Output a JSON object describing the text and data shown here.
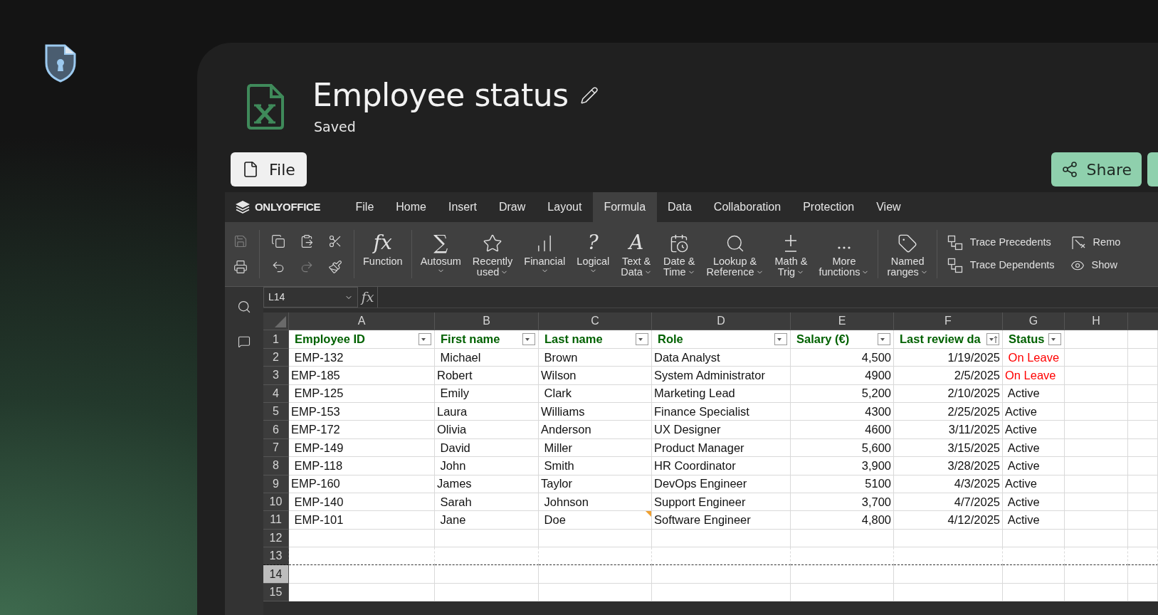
{
  "document": {
    "title": "Employee status",
    "status": "Saved"
  },
  "file_button": {
    "label": "File"
  },
  "share_button": {
    "label": "Share"
  },
  "editor": {
    "brand": "ONLYOFFICE",
    "menu": [
      {
        "label": "File",
        "selected": false
      },
      {
        "label": "Home",
        "selected": false
      },
      {
        "label": "Insert",
        "selected": false
      },
      {
        "label": "Draw",
        "selected": false
      },
      {
        "label": "Layout",
        "selected": false
      },
      {
        "label": "Formula",
        "selected": true
      },
      {
        "label": "Data",
        "selected": false
      },
      {
        "label": "Collaboration",
        "selected": false
      },
      {
        "label": "Protection",
        "selected": false
      },
      {
        "label": "View",
        "selected": false
      }
    ],
    "small_tools": [
      {
        "disabled": true
      },
      {
        "disabled": false
      },
      {
        "disabled": false
      },
      {
        "disabled": false
      },
      {
        "disabled": false
      },
      {
        "disabled": false
      },
      {
        "disabled": true
      },
      {
        "disabled": false
      }
    ],
    "function_groups": [
      [
        {
          "lines": [
            "Function"
          ],
          "symbol": "fx",
          "has_menu": false
        }
      ],
      [
        {
          "lines": [
            "Autosum"
          ],
          "symbol": "∑",
          "has_menu": true,
          "caret_on_own_line": true
        },
        {
          "lines": [
            "Recently",
            "used"
          ],
          "has_menu": true,
          "caret_on_own_line": false
        },
        {
          "lines": [
            "Financial"
          ],
          "has_menu": true,
          "caret_on_own_line": true
        },
        {
          "lines": [
            "Logical"
          ],
          "symbol": "?",
          "has_menu": true,
          "caret_on_own_line": true
        },
        {
          "lines": [
            "Text &",
            "Data"
          ],
          "symbol": "A",
          "has_menu": true,
          "caret_on_own_line": false
        },
        {
          "lines": [
            "Date &",
            "Time"
          ],
          "has_menu": true,
          "caret_on_own_line": false
        },
        {
          "lines": [
            "Lookup &",
            "Reference"
          ],
          "has_menu": true,
          "caret_on_own_line": false
        },
        {
          "lines": [
            "Math &",
            "Trig"
          ],
          "has_menu": true,
          "caret_on_own_line": false
        },
        {
          "lines": [
            "More",
            "functions"
          ],
          "has_menu": true,
          "caret_on_own_line": false
        }
      ],
      [
        {
          "lines": [
            "Named",
            "ranges"
          ],
          "has_menu": true,
          "caret_on_own_line": false
        }
      ]
    ],
    "trace_tools": [
      {
        "label": "Trace Precedents"
      },
      {
        "label": "Trace Dependents"
      },
      {
        "label": "Remo"
      },
      {
        "label": "Show"
      }
    ],
    "name_box": "L14",
    "formula_symbol": "fx"
  },
  "sheet": {
    "columns": [
      "A",
      "B",
      "C",
      "D",
      "E",
      "F",
      "G",
      "H"
    ],
    "row_numbers": [
      {
        "label": "1",
        "selected": false,
        "page_break": false
      },
      {
        "label": "2",
        "selected": false,
        "page_break": false
      },
      {
        "label": "3",
        "selected": false,
        "page_break": false
      },
      {
        "label": "4",
        "selected": false,
        "page_break": false
      },
      {
        "label": "5",
        "selected": false,
        "page_break": false
      },
      {
        "label": "6",
        "selected": false,
        "page_break": false
      },
      {
        "label": "7",
        "selected": false,
        "page_break": false
      },
      {
        "label": "8",
        "selected": false,
        "page_break": false
      },
      {
        "label": "9",
        "selected": false,
        "page_break": false
      },
      {
        "label": "10",
        "selected": false,
        "page_break": false
      },
      {
        "label": "11",
        "selected": false,
        "page_break": false
      },
      {
        "label": "12",
        "selected": false,
        "page_break": false
      },
      {
        "label": "13",
        "selected": false,
        "page_break": true
      },
      {
        "label": "14",
        "selected": true,
        "page_break": false
      },
      {
        "label": "15",
        "selected": false,
        "page_break": false
      }
    ],
    "headers": [
      {
        "label": "Employee ID",
        "sorted": false
      },
      {
        "label": "First name",
        "sorted": false
      },
      {
        "label": "Last name",
        "sorted": false
      },
      {
        "label": "Role",
        "sorted": false
      },
      {
        "label": "Salary (€)",
        "sorted": false
      },
      {
        "label": "Last review da",
        "sorted": true
      },
      {
        "label": "Status",
        "sorted": false
      }
    ],
    "rows": [
      {
        "cells": [
          " EMP-132",
          " Michael",
          " Brown",
          "Data Analyst",
          "4,500",
          "1/19/2025"
        ],
        "status": " On Leave",
        "on_leave": true,
        "comment": false
      },
      {
        "cells": [
          "EMP-185",
          "Robert",
          "Wilson",
          "System Administrator",
          "4900",
          "2/5/2025"
        ],
        "status": "On Leave",
        "on_leave": true,
        "comment": false
      },
      {
        "cells": [
          " EMP-125",
          " Emily",
          " Clark",
          "Marketing Lead",
          "5,200",
          "2/10/2025"
        ],
        "status": " Active",
        "on_leave": false,
        "comment": false
      },
      {
        "cells": [
          "EMP-153",
          "Laura",
          "Williams",
          "Finance Specialist",
          "4300",
          "2/25/2025"
        ],
        "status": "Active",
        "on_leave": false,
        "comment": false
      },
      {
        "cells": [
          "EMP-172",
          "Olivia",
          "Anderson",
          "UX Designer",
          "4600",
          "3/11/2025"
        ],
        "status": "Active",
        "on_leave": false,
        "comment": false
      },
      {
        "cells": [
          " EMP-149",
          " David",
          " Miller",
          "Product Manager",
          "5,600",
          "3/15/2025"
        ],
        "status": " Active",
        "on_leave": false,
        "comment": false
      },
      {
        "cells": [
          " EMP-118",
          " John",
          " Smith",
          "HR Coordinator",
          "3,900",
          "3/28/2025"
        ],
        "status": " Active",
        "on_leave": false,
        "comment": false
      },
      {
        "cells": [
          "EMP-160",
          "James",
          "Taylor",
          "DevOps Engineer",
          "5100",
          "4/3/2025"
        ],
        "status": "Active",
        "on_leave": false,
        "comment": false
      },
      {
        "cells": [
          " EMP-140",
          " Sarah",
          " Johnson",
          "Support Engineer",
          "3,700",
          "4/7/2025"
        ],
        "status": " Active",
        "on_leave": false,
        "comment": false
      },
      {
        "cells": [
          " EMP-101",
          " Jane",
          " Doe",
          "Software Engineer",
          "4,800",
          "4/12/2025"
        ],
        "status": " Active",
        "on_leave": false,
        "comment": true
      }
    ]
  }
}
